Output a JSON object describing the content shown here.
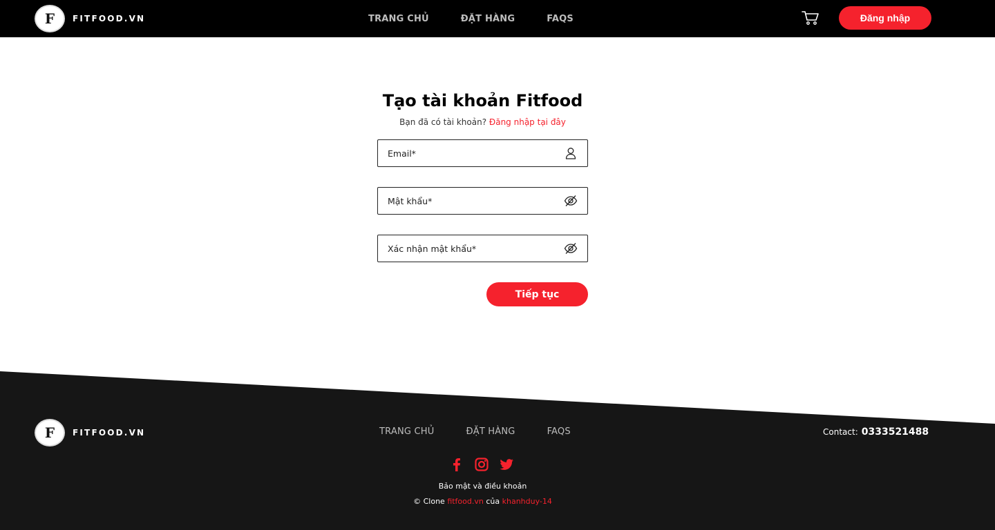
{
  "brand": {
    "name": "FITFOOD.VN",
    "logo_letter": "F"
  },
  "header": {
    "nav": [
      "TRANG CHỦ",
      "ĐẶT HÀNG",
      "FAQS"
    ],
    "login_label": "Đăng nhập"
  },
  "form": {
    "title": "Tạo tài khoản Fitfood",
    "subtitle_text": "Bạn đã có tài khoản?",
    "subtitle_link": "Đăng nhập tại đây",
    "fields": [
      {
        "label": "Email*",
        "icon": "user-icon"
      },
      {
        "label": "Mật khẩu*",
        "icon": "eye-off-icon"
      },
      {
        "label": "Xác nhận mật khẩu*",
        "icon": "eye-off-icon"
      }
    ],
    "submit_label": "Tiếp tục"
  },
  "footer": {
    "nav": [
      "TRANG CHỦ",
      "ĐẶT HÀNG",
      "FAQS"
    ],
    "contact_label": "Contact:",
    "contact_phone": "0333521488",
    "social": [
      "facebook-icon",
      "instagram-icon",
      "twitter-icon"
    ],
    "policy": "Bảo mật và điều khoản",
    "copyright_prefix": "© Clone",
    "copyright_site": "fitfood.vn",
    "copyright_mid": "của",
    "copyright_author": "khanhduy-14"
  },
  "colors": {
    "accent": "#f5222d",
    "header_bg": "#000000",
    "footer_bg": "#161616"
  }
}
